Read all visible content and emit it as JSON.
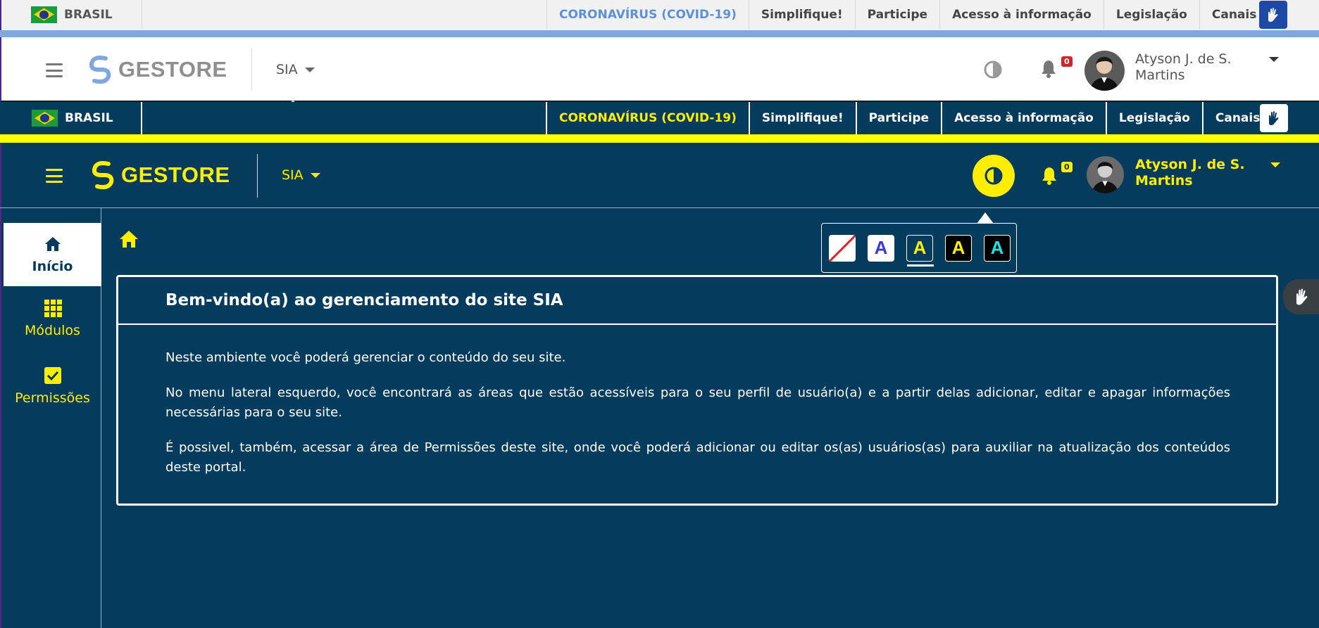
{
  "govbar": {
    "country": "BRASIL",
    "links": [
      {
        "label": "CORONAVÍRUS (COVID-19)"
      },
      {
        "label": "Simplifique!"
      },
      {
        "label": "Participe"
      },
      {
        "label": "Acesso à informação"
      },
      {
        "label": "Legislação"
      },
      {
        "label": "Canais"
      }
    ]
  },
  "header": {
    "logo_text": "GESTORE",
    "system": "SIA",
    "notification_count": "0",
    "user": {
      "name_line1": "Atyson J. de S.",
      "name_line2": "Martins"
    }
  },
  "contrast_menu": {
    "options": [
      "none",
      "A",
      "A",
      "A",
      "A"
    ],
    "selected_index": 2
  },
  "sidebar": {
    "items": [
      {
        "label": "Início",
        "icon": "home-icon",
        "active": true
      },
      {
        "label": "Módulos",
        "icon": "grid-icon",
        "active": false
      },
      {
        "label": "Permissões",
        "icon": "checkbox-icon",
        "active": false
      }
    ]
  },
  "main": {
    "title": "Bem-vindo(a) ao gerenciamento do site SIA",
    "paragraphs": [
      "Neste ambiente você poderá gerenciar o conteúdo do seu site.",
      "No menu lateral esquerdo, você encontrará as áreas que estão acessíveis para o seu perfil de usuário(a) e a partir delas adicionar, editar e apagar informações necessárias para o seu site.",
      "É possivel, também, acessar a área de Permissões deste site, onde você poderá adicionar ou editar os(as) usuários(as) para auxiliar na atualização dos conteúdos deste portal."
    ]
  },
  "colors": {
    "dark_bg": "#053b5c",
    "highlight_yellow": "#ffee00",
    "light_covid_link": "#5b91d8",
    "gov_blue": "#1d4aa5"
  }
}
